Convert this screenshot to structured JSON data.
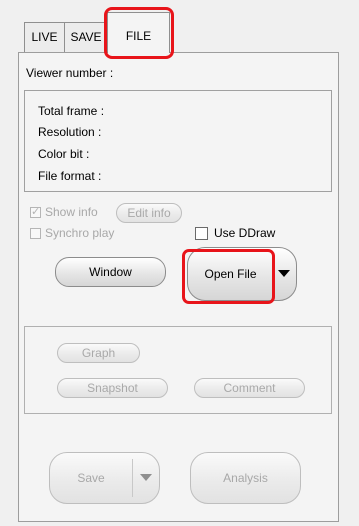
{
  "tabs": [
    {
      "label": "LIVE"
    },
    {
      "label": "SAVE"
    },
    {
      "label": "FILE"
    }
  ],
  "viewer": {
    "label": "Viewer number :"
  },
  "info": {
    "total_frame": "Total frame :",
    "resolution": "Resolution :",
    "color_bit": "Color bit :",
    "file_format": "File format :"
  },
  "options": {
    "show_info": "Show info",
    "edit_info": "Edit info",
    "synchro_play": "Synchro play",
    "use_ddraw": "Use DDraw"
  },
  "buttons": {
    "window": "Window",
    "open_file": "Open File",
    "graph": "Graph",
    "snapshot": "Snapshot",
    "comment": "Comment",
    "save": "Save",
    "analysis": "Analysis"
  },
  "colors": {
    "highlight": "#e8141a",
    "disabled_text": "#a8a8a8"
  }
}
